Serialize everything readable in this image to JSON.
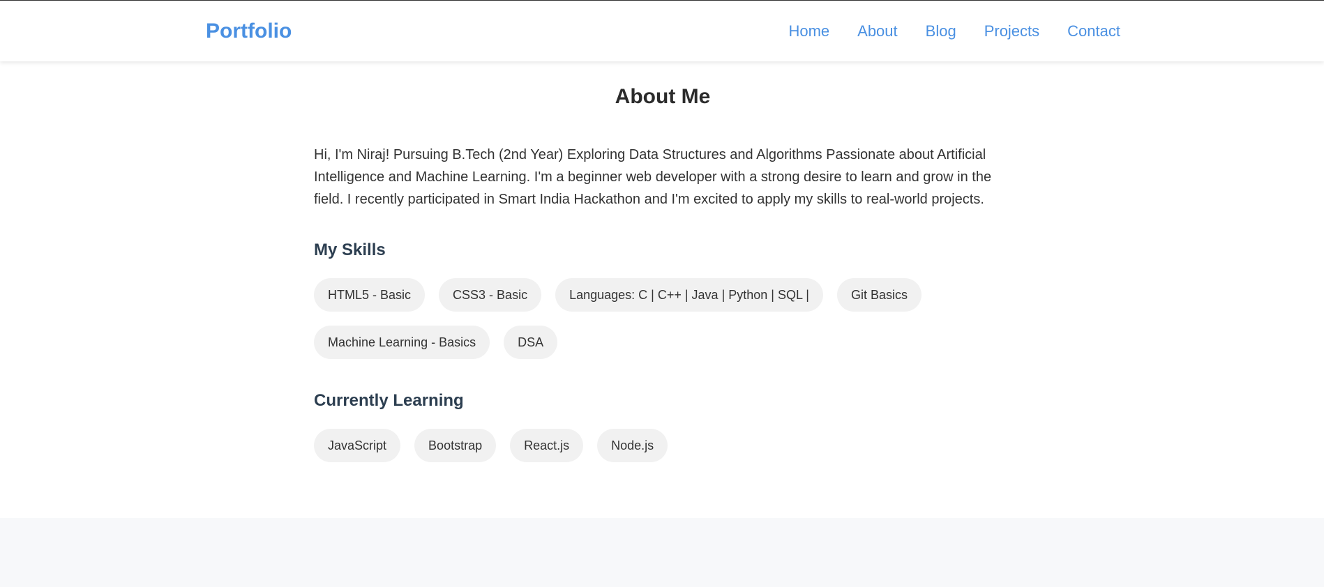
{
  "header": {
    "logo": "Portfolio",
    "nav": [
      "Home",
      "About",
      "Blog",
      "Projects",
      "Contact"
    ]
  },
  "about": {
    "title": "About Me",
    "bio": "Hi, I'm Niraj! Pursuing B.Tech (2nd Year) Exploring Data Structures and Algorithms Passionate about Artificial Intelligence and Machine Learning. I'm a beginner web developer with a strong desire to learn and grow in the field. I recently participated in Smart India Hackathon and I'm excited to apply my skills to real-world projects."
  },
  "skills": {
    "heading": "My Skills",
    "items": [
      "HTML5 - Basic",
      "CSS3 - Basic",
      "Languages: C | C++ | Java | Python | SQL |",
      "Git Basics",
      "Machine Learning - Basics",
      "DSA"
    ]
  },
  "learning": {
    "heading": "Currently Learning",
    "items": [
      "JavaScript",
      "Bootstrap",
      "React.js",
      "Node.js"
    ]
  },
  "colors": {
    "accent": "#4a90e2",
    "heading": "#2c3e50",
    "tag_bg": "#f1f1f1",
    "footer_bg": "#f7f8fa"
  }
}
